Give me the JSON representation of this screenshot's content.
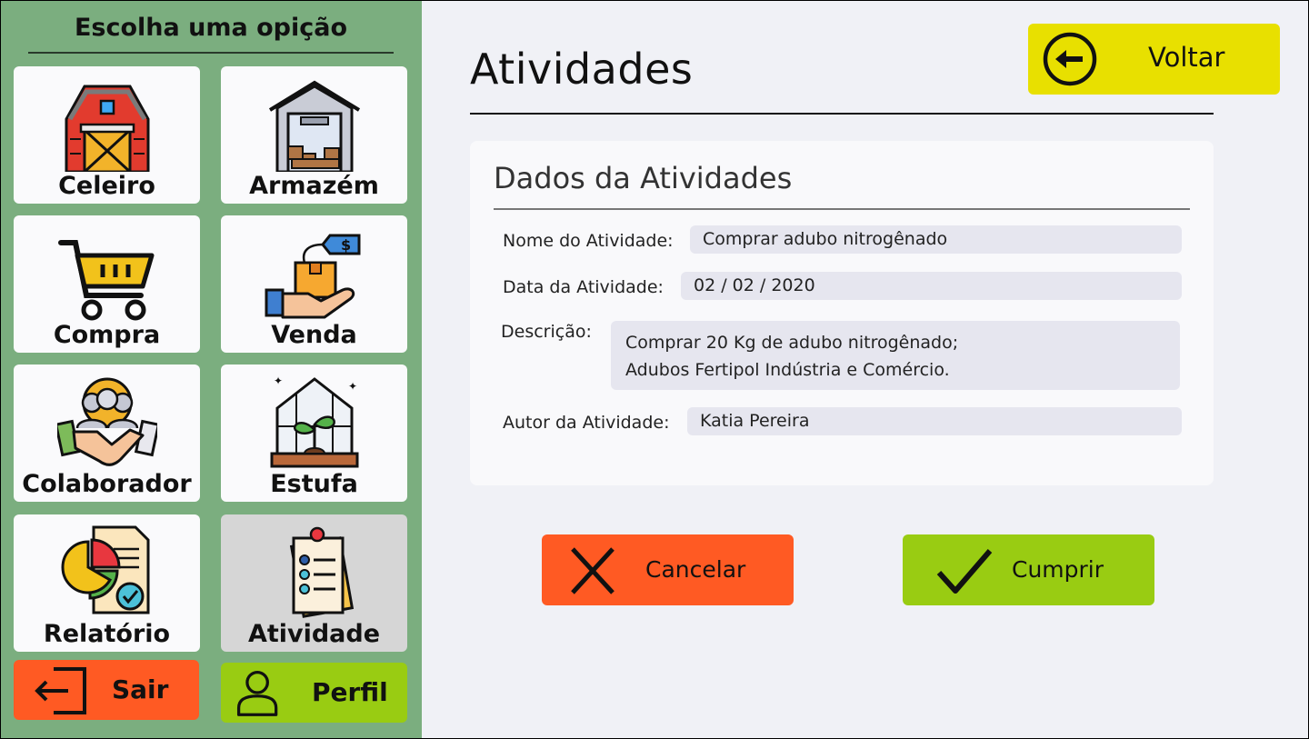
{
  "sidebar": {
    "title": "Escolha uma opição",
    "tiles": [
      {
        "label": "Celeiro",
        "icon": "barn-icon"
      },
      {
        "label": "Armazém",
        "icon": "warehouse-icon"
      },
      {
        "label": "Compra",
        "icon": "shopping-cart-icon"
      },
      {
        "label": "Venda",
        "icon": "sale-hand-box-icon"
      },
      {
        "label": "Colaborador",
        "icon": "handshake-team-icon"
      },
      {
        "label": "Estufa",
        "icon": "greenhouse-icon"
      },
      {
        "label": "Relatório",
        "icon": "report-pie-chart-icon"
      },
      {
        "label": "Atividade",
        "icon": "checklist-clipboard-icon"
      }
    ],
    "active_tile": "Atividade",
    "logout_label": "Sair",
    "profile_label": "Perfil"
  },
  "header": {
    "title": "Atividades",
    "back_label": "Voltar"
  },
  "form": {
    "title": "Dados da Atividades",
    "name_label": "Nome do Atividade:",
    "name_value": "Comprar adubo nitrogênado",
    "date_label": "Data da Atividade:",
    "date_value": "02 / 02 / 2020",
    "description_label": "Descrição:",
    "description_value": "Comprar 20 Kg de adubo nitrogênado;\nAdubos Fertipol Indústria e Comércio.",
    "author_label": "Autor da Atividade:",
    "author_value": "Katia Pereira"
  },
  "actions": {
    "cancel_label": "Cancelar",
    "confirm_label": "Cumprir"
  },
  "colors": {
    "sidebar_bg": "#7bae7f",
    "back_button": "#e8e000",
    "cancel_button": "#ff5a23",
    "confirm_button": "#99cc12",
    "logout_button": "#ff5a23",
    "profile_button": "#99cc12"
  }
}
